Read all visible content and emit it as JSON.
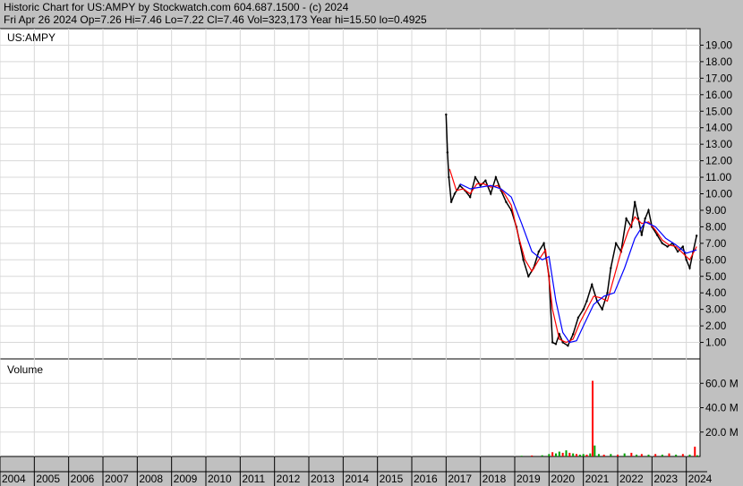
{
  "header": {
    "line1": "Historic Chart for US:AMPY by Stockwatch.com 604.687.1500 - (c) 2024",
    "line2": "Fri Apr 26 2024   Op=7.26   Hi=7.46   Lo=7.22   Cl=7.46   Vol=323,173   Year hi=15.50   lo=0.4925"
  },
  "chart_data": [
    {
      "type": "line",
      "title": "US:AMPY",
      "x_range": [
        2004,
        2024.4
      ],
      "ylim": [
        0,
        20
      ],
      "y_ticks": [
        "1.00",
        "2.00",
        "3.00",
        "4.00",
        "5.00",
        "6.00",
        "7.00",
        "8.00",
        "9.00",
        "10.00",
        "11.00",
        "12.00",
        "13.00",
        "14.00",
        "15.00",
        "16.00",
        "17.00",
        "18.00",
        "19.00"
      ],
      "grid": true,
      "colors": {
        "price": "#000000",
        "ma_short": "#ff0000",
        "ma_long": "#0000ff"
      },
      "series": [
        {
          "key": "price",
          "x": [
            2017.0,
            2017.04,
            2017.08,
            2017.15,
            2017.25,
            2017.4,
            2017.55,
            2017.7,
            2017.85,
            2018.0,
            2018.15,
            2018.3,
            2018.45,
            2018.6,
            2018.75,
            2018.9,
            2019.05,
            2019.15,
            2019.25,
            2019.4,
            2019.55,
            2019.7,
            2019.85,
            2020.0,
            2020.1,
            2020.2,
            2020.3,
            2020.4,
            2020.55,
            2020.7,
            2020.85,
            2021.0,
            2021.1,
            2021.25,
            2021.4,
            2021.55,
            2021.7,
            2021.8,
            2021.95,
            2022.1,
            2022.25,
            2022.4,
            2022.5,
            2022.6,
            2022.7,
            2022.8,
            2022.9,
            2023.0,
            2023.15,
            2023.3,
            2023.45,
            2023.6,
            2023.75,
            2023.9,
            2024.0,
            2024.1,
            2024.2,
            2024.3
          ],
          "values": [
            14.8,
            12.5,
            11.0,
            9.5,
            10.0,
            10.5,
            10.2,
            9.8,
            11.0,
            10.5,
            10.8,
            10.0,
            11.0,
            10.2,
            9.5,
            9.0,
            8.0,
            7.0,
            6.0,
            5.0,
            5.5,
            6.5,
            7.0,
            5.0,
            1.0,
            0.9,
            1.5,
            1.0,
            0.8,
            1.5,
            2.5,
            3.0,
            3.5,
            4.5,
            3.5,
            3.0,
            4.0,
            5.5,
            7.0,
            6.5,
            8.5,
            8.0,
            9.5,
            8.5,
            7.5,
            8.5,
            9.0,
            8.0,
            7.5,
            7.0,
            6.8,
            7.0,
            6.5,
            6.8,
            6.0,
            5.5,
            6.5,
            7.46
          ]
        },
        {
          "key": "ma_short",
          "x": [
            2017.1,
            2017.3,
            2017.5,
            2017.7,
            2017.9,
            2018.1,
            2018.3,
            2018.5,
            2018.7,
            2018.9,
            2019.1,
            2019.3,
            2019.5,
            2019.7,
            2019.9,
            2020.1,
            2020.3,
            2020.5,
            2020.7,
            2020.9,
            2021.1,
            2021.3,
            2021.5,
            2021.7,
            2021.9,
            2022.1,
            2022.3,
            2022.5,
            2022.7,
            2022.9,
            2023.1,
            2023.3,
            2023.5,
            2023.7,
            2023.9,
            2024.1,
            2024.3
          ],
          "values": [
            11.5,
            10.2,
            10.3,
            10.0,
            10.6,
            10.6,
            10.4,
            10.5,
            10.0,
            9.3,
            7.5,
            6.0,
            5.3,
            6.0,
            6.6,
            3.0,
            1.2,
            1.0,
            1.2,
            2.2,
            3.0,
            3.8,
            3.7,
            3.5,
            5.0,
            6.5,
            7.7,
            8.6,
            8.2,
            8.3,
            7.8,
            7.2,
            6.9,
            6.8,
            6.4,
            6.0,
            6.8
          ]
        },
        {
          "key": "ma_long",
          "x": [
            2017.4,
            2017.7,
            2018.0,
            2018.3,
            2018.6,
            2018.9,
            2019.2,
            2019.5,
            2019.8,
            2020.0,
            2020.2,
            2020.4,
            2020.6,
            2020.8,
            2021.0,
            2021.3,
            2021.6,
            2021.9,
            2022.2,
            2022.5,
            2022.8,
            2023.1,
            2023.4,
            2023.7,
            2024.0,
            2024.3
          ],
          "values": [
            10.6,
            10.3,
            10.4,
            10.5,
            10.3,
            9.8,
            8.2,
            6.5,
            6.0,
            6.2,
            3.5,
            1.6,
            1.0,
            1.1,
            2.0,
            3.3,
            3.8,
            4.0,
            5.5,
            7.3,
            8.3,
            8.0,
            7.3,
            6.9,
            6.4,
            6.6
          ]
        }
      ]
    },
    {
      "type": "bar",
      "title": "Volume",
      "ylim": [
        0,
        80
      ],
      "y_ticks": [
        "20.0 M",
        "40.0 M",
        "60.0 M"
      ],
      "x_ticks": [
        "2004",
        "2005",
        "2006",
        "2007",
        "2008",
        "2009",
        "2010",
        "2011",
        "2012",
        "2013",
        "2014",
        "2015",
        "2016",
        "2017",
        "2018",
        "2019",
        "2020",
        "2021",
        "2022",
        "2023",
        "2024"
      ],
      "colors": {
        "up": "#00a000",
        "down": "#ff0000"
      },
      "bars": [
        {
          "x": 2019.2,
          "v": 0.6,
          "up": true
        },
        {
          "x": 2019.5,
          "v": 0.8,
          "up": false
        },
        {
          "x": 2019.8,
          "v": 1.0,
          "up": true
        },
        {
          "x": 2020.0,
          "v": 2.0,
          "up": true
        },
        {
          "x": 2020.1,
          "v": 3.5,
          "up": false
        },
        {
          "x": 2020.2,
          "v": 2.5,
          "up": true
        },
        {
          "x": 2020.3,
          "v": 4.0,
          "up": true
        },
        {
          "x": 2020.4,
          "v": 3.0,
          "up": false
        },
        {
          "x": 2020.5,
          "v": 5.0,
          "up": true
        },
        {
          "x": 2020.6,
          "v": 3.0,
          "up": false
        },
        {
          "x": 2020.7,
          "v": 2.5,
          "up": true
        },
        {
          "x": 2020.8,
          "v": 2.0,
          "up": false
        },
        {
          "x": 2020.9,
          "v": 1.5,
          "up": true
        },
        {
          "x": 2021.0,
          "v": 2.0,
          "up": true
        },
        {
          "x": 2021.1,
          "v": 1.5,
          "up": false
        },
        {
          "x": 2021.2,
          "v": 2.5,
          "up": true
        },
        {
          "x": 2021.27,
          "v": 62.0,
          "up": false
        },
        {
          "x": 2021.33,
          "v": 9.0,
          "up": true
        },
        {
          "x": 2021.45,
          "v": 2.0,
          "up": true
        },
        {
          "x": 2021.6,
          "v": 1.5,
          "up": false
        },
        {
          "x": 2021.8,
          "v": 2.0,
          "up": true
        },
        {
          "x": 2022.0,
          "v": 1.5,
          "up": false
        },
        {
          "x": 2022.2,
          "v": 2.5,
          "up": true
        },
        {
          "x": 2022.4,
          "v": 3.0,
          "up": false
        },
        {
          "x": 2022.55,
          "v": 1.5,
          "up": true
        },
        {
          "x": 2022.7,
          "v": 2.0,
          "up": false
        },
        {
          "x": 2022.9,
          "v": 1.5,
          "up": true
        },
        {
          "x": 2023.1,
          "v": 2.0,
          "up": false
        },
        {
          "x": 2023.3,
          "v": 1.5,
          "up": true
        },
        {
          "x": 2023.5,
          "v": 2.5,
          "up": false
        },
        {
          "x": 2023.7,
          "v": 1.5,
          "up": true
        },
        {
          "x": 2023.9,
          "v": 2.0,
          "up": false
        },
        {
          "x": 2024.1,
          "v": 1.5,
          "up": true
        },
        {
          "x": 2024.25,
          "v": 8.0,
          "up": false
        },
        {
          "x": 2024.32,
          "v": 1.0,
          "up": true
        }
      ]
    }
  ]
}
